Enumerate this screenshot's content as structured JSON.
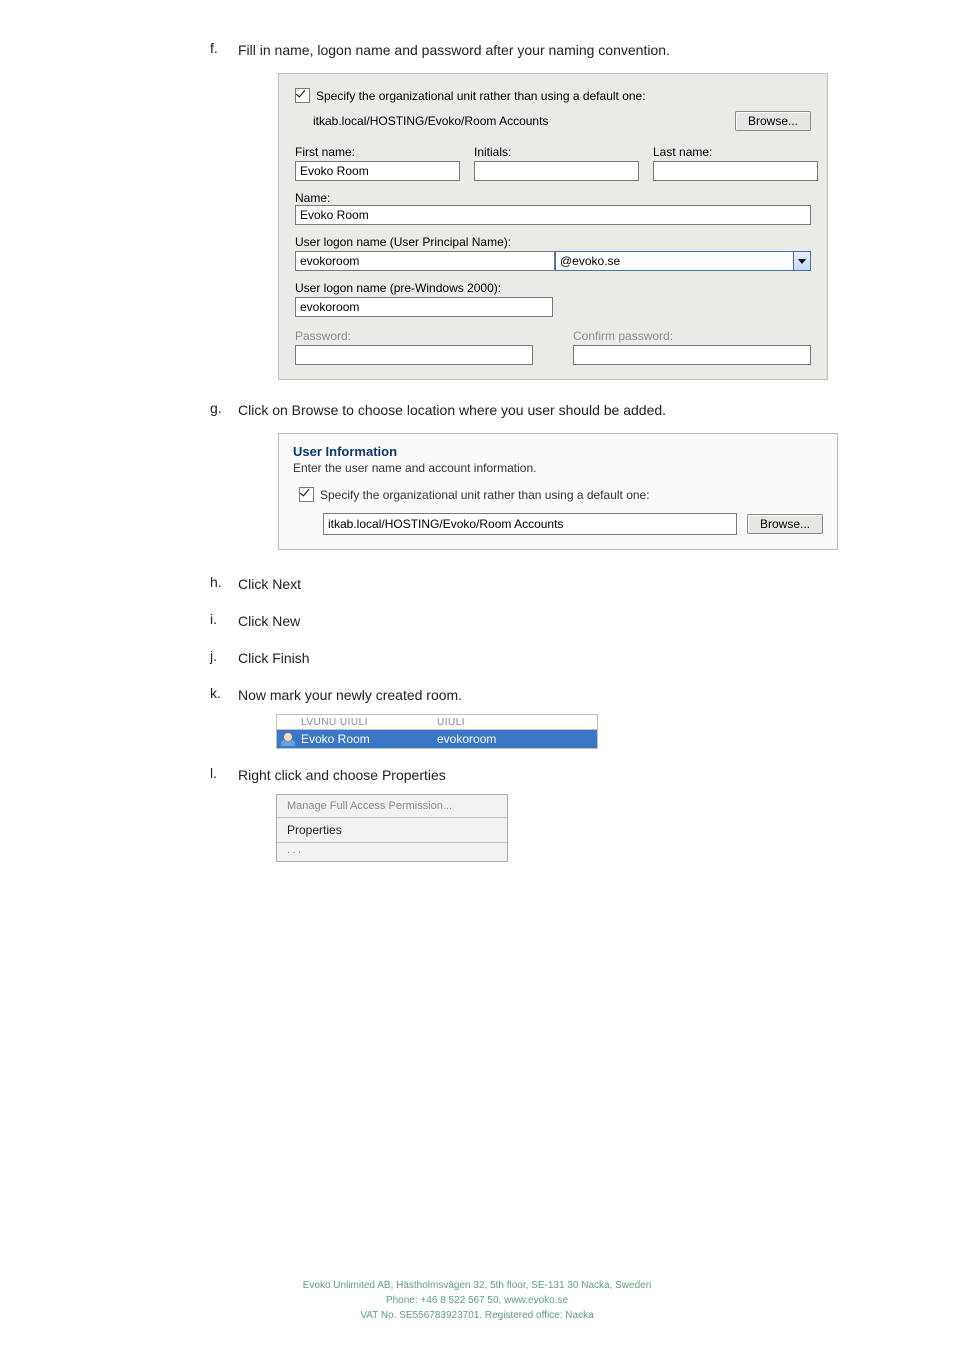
{
  "items": {
    "f": {
      "letter": "f.",
      "text": "Fill in name, logon name and password after your naming convention."
    },
    "g": {
      "letter": "g.",
      "text": "Click on Browse to choose location where you user should be added."
    },
    "h": {
      "letter": "h.",
      "text": "Click Next"
    },
    "i": {
      "letter": "i.",
      "text": "Click New"
    },
    "j": {
      "letter": "j.",
      "text": "Click Finish"
    },
    "k": {
      "letter": "k.",
      "text": "Now mark your newly created room."
    },
    "l": {
      "letter": "l.",
      "text": "Right click and choose Properties"
    }
  },
  "dialog1": {
    "specify_label": "Specify the organizational unit rather than using a default one:",
    "ou_path": "itkab.local/HOSTING/Evoko/Room Accounts",
    "browse": "Browse...",
    "first_name_lbl": "First name:",
    "first_name_val": "Evoko Room",
    "initials_lbl": "Initials:",
    "last_name_lbl": "Last name:",
    "name_lbl": "Name:",
    "name_val": "Evoko Room",
    "upn_lbl": "User logon name (User Principal Name):",
    "upn_val": "evokoroom",
    "upn_domain": "@evoko.se",
    "prewin_lbl": "User logon name (pre-Windows 2000):",
    "prewin_val": "evokoroom",
    "password_lbl": "Password:",
    "confirm_lbl": "Confirm password:"
  },
  "userinfo": {
    "title": "User Information",
    "subtitle": "Enter the user name and account information.",
    "specify_label": "Specify the organizational unit rather than using a default one:",
    "ou_path": "itkab.local/HOSTING/Evoko/Room Accounts",
    "browse": "Browse..."
  },
  "room_list": {
    "col1_hint": "LVUNU UIULI",
    "col2_hint": "UIULI",
    "name": "Evoko Room",
    "logon": "evokoroom"
  },
  "ctx": {
    "dim": "Manage Full Access Permission...",
    "properties": "Properties"
  },
  "footer": {
    "l1": "Evoko Unlimited AB,  Hästholmsvägen 32, 5th floor, SE-131 30 Nacka, Sweden",
    "l2": "Phone: +46 8 522 567 50,  www.evoko.se",
    "l3": "VAT No. SE556783923701. Registered office: Nacka"
  }
}
